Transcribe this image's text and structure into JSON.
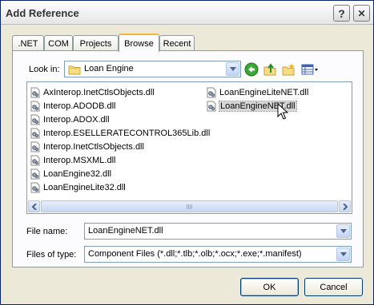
{
  "window": {
    "title": "Add Reference",
    "help_label": "?",
    "close_label": "✕"
  },
  "tabs": [
    {
      "label": ".NET"
    },
    {
      "label": "COM"
    },
    {
      "label": "Projects"
    },
    {
      "label": "Browse",
      "active": true
    },
    {
      "label": "Recent"
    }
  ],
  "lookin": {
    "label": "Look in:",
    "value": "Loan Engine"
  },
  "files": [
    {
      "name": "AxInterop.InetCtlsObjects.dll"
    },
    {
      "name": "Interop.ADODB.dll"
    },
    {
      "name": "Interop.ADOX.dll"
    },
    {
      "name": "Interop.ESELLERATECONTROL365Lib.dll"
    },
    {
      "name": "Interop.InetCtlsObjects.dll"
    },
    {
      "name": "Interop.MSXML.dll"
    },
    {
      "name": "LoanEngine32.dll"
    },
    {
      "name": "LoanEngineLite32.dll"
    },
    {
      "name": "LoanEngineLiteNET.dll"
    },
    {
      "name": "LoanEngineNET.dll",
      "selected": true
    }
  ],
  "filename": {
    "label": "File name:",
    "value": "LoanEngineNET.dll"
  },
  "filetype": {
    "label": "Files of type:",
    "value": "Component Files (*.dll;*.tlb;*.olb;*.ocx;*.exe;*.manifest)"
  },
  "buttons": {
    "ok": "OK",
    "cancel": "Cancel"
  },
  "icons": {
    "folder": "folder-icon",
    "back": "back-arrow-icon",
    "up": "up-folder-icon",
    "new_folder": "new-folder-icon",
    "views": "views-menu-icon",
    "dll": "dll-file-icon",
    "cursor": "mouse-pointer-icon"
  },
  "colors": {
    "title_bar": "#f4f4f4",
    "dialog_face": "#ece9d8",
    "tab_accent": "#f2b738",
    "border_blue": "#7f9db9",
    "back_green": "#3aa635"
  }
}
